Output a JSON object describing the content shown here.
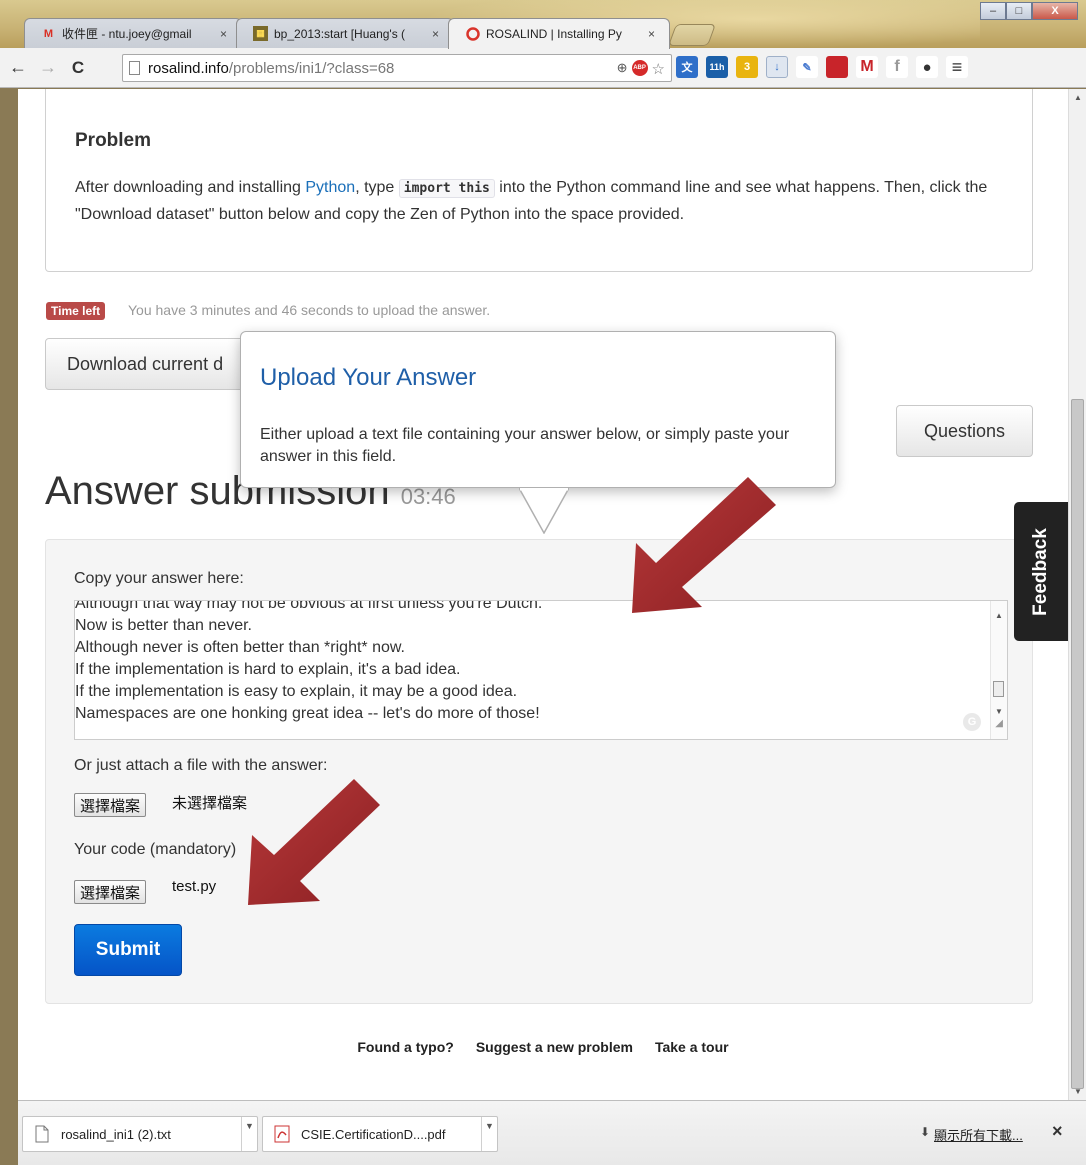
{
  "browser": {
    "tabs": [
      {
        "label": "收件匣 - ntu.joey@gmail",
        "icon": "gmail-icon",
        "active": false
      },
      {
        "label": "bp_2013:start [Huang's (",
        "icon": "wiki-icon",
        "active": false
      },
      {
        "label": "ROSALIND | Installing Py",
        "icon": "rosalind-icon",
        "active": true
      }
    ],
    "tab_close": "×",
    "window_controls": {
      "minimize": "–",
      "maximize": "□",
      "close": "X"
    },
    "nav": {
      "back": "←",
      "forward": "→",
      "reload": "C"
    },
    "url": {
      "host": "rosalind.info",
      "path": "/problems/ini1/?class=68"
    },
    "menu": "≡"
  },
  "problem": {
    "title": "Problem",
    "text_before_link": "After downloading and installing ",
    "link": "Python",
    "text_before_code": ", type ",
    "code": "import this",
    "text_after_code": " into the Python command line and see what happens. Then, click the \"Download dataset\" button below and copy the Zen of Python into the space provided."
  },
  "timer": {
    "badge": "Time left",
    "text": "You have 3 minutes and 46 seconds to upload the answer."
  },
  "buttons": {
    "download": "Download current d",
    "questions": "Questions",
    "submit": "Submit",
    "choose_file": "選擇檔案"
  },
  "popover": {
    "title": "Upload Your Answer",
    "body": "Either upload a text file containing your answer below, or simply paste your answer in this field."
  },
  "answer": {
    "heading": "Answer submission",
    "countdown": "03:46",
    "copy_label": "Copy your answer here:",
    "lines": [
      "Although that way may not be obvious at first unless you're Dutch.",
      "Now is better than never.",
      "Although never is often better than *right* now.",
      "If the implementation is hard to explain, it's a bad idea.",
      "If the implementation is easy to explain, it may be a good idea.",
      "Namespaces are one honking great idea -- let's do more of those!"
    ],
    "attach_label": "Or just attach a file with the answer:",
    "attach_status": "未選擇檔案",
    "code_label": "Your code (mandatory)",
    "code_file": "test.py"
  },
  "feedback": "Feedback",
  "footer": {
    "typo": "Found a typo?",
    "suggest": "Suggest a new problem",
    "tour": "Take a tour"
  },
  "downloads": {
    "items": [
      {
        "name": "rosalind_ini1 (2).txt",
        "icon": "text-file-icon"
      },
      {
        "name": "CSIE.CertificationD....pdf",
        "icon": "pdf-file-icon"
      }
    ],
    "show_all": "顯示所有下載...",
    "close": "×"
  },
  "colors": {
    "link": "#1a6fb9",
    "badge": "#b94a48",
    "submit": "#0554c7",
    "annotation_arrow": "#a0282a"
  }
}
